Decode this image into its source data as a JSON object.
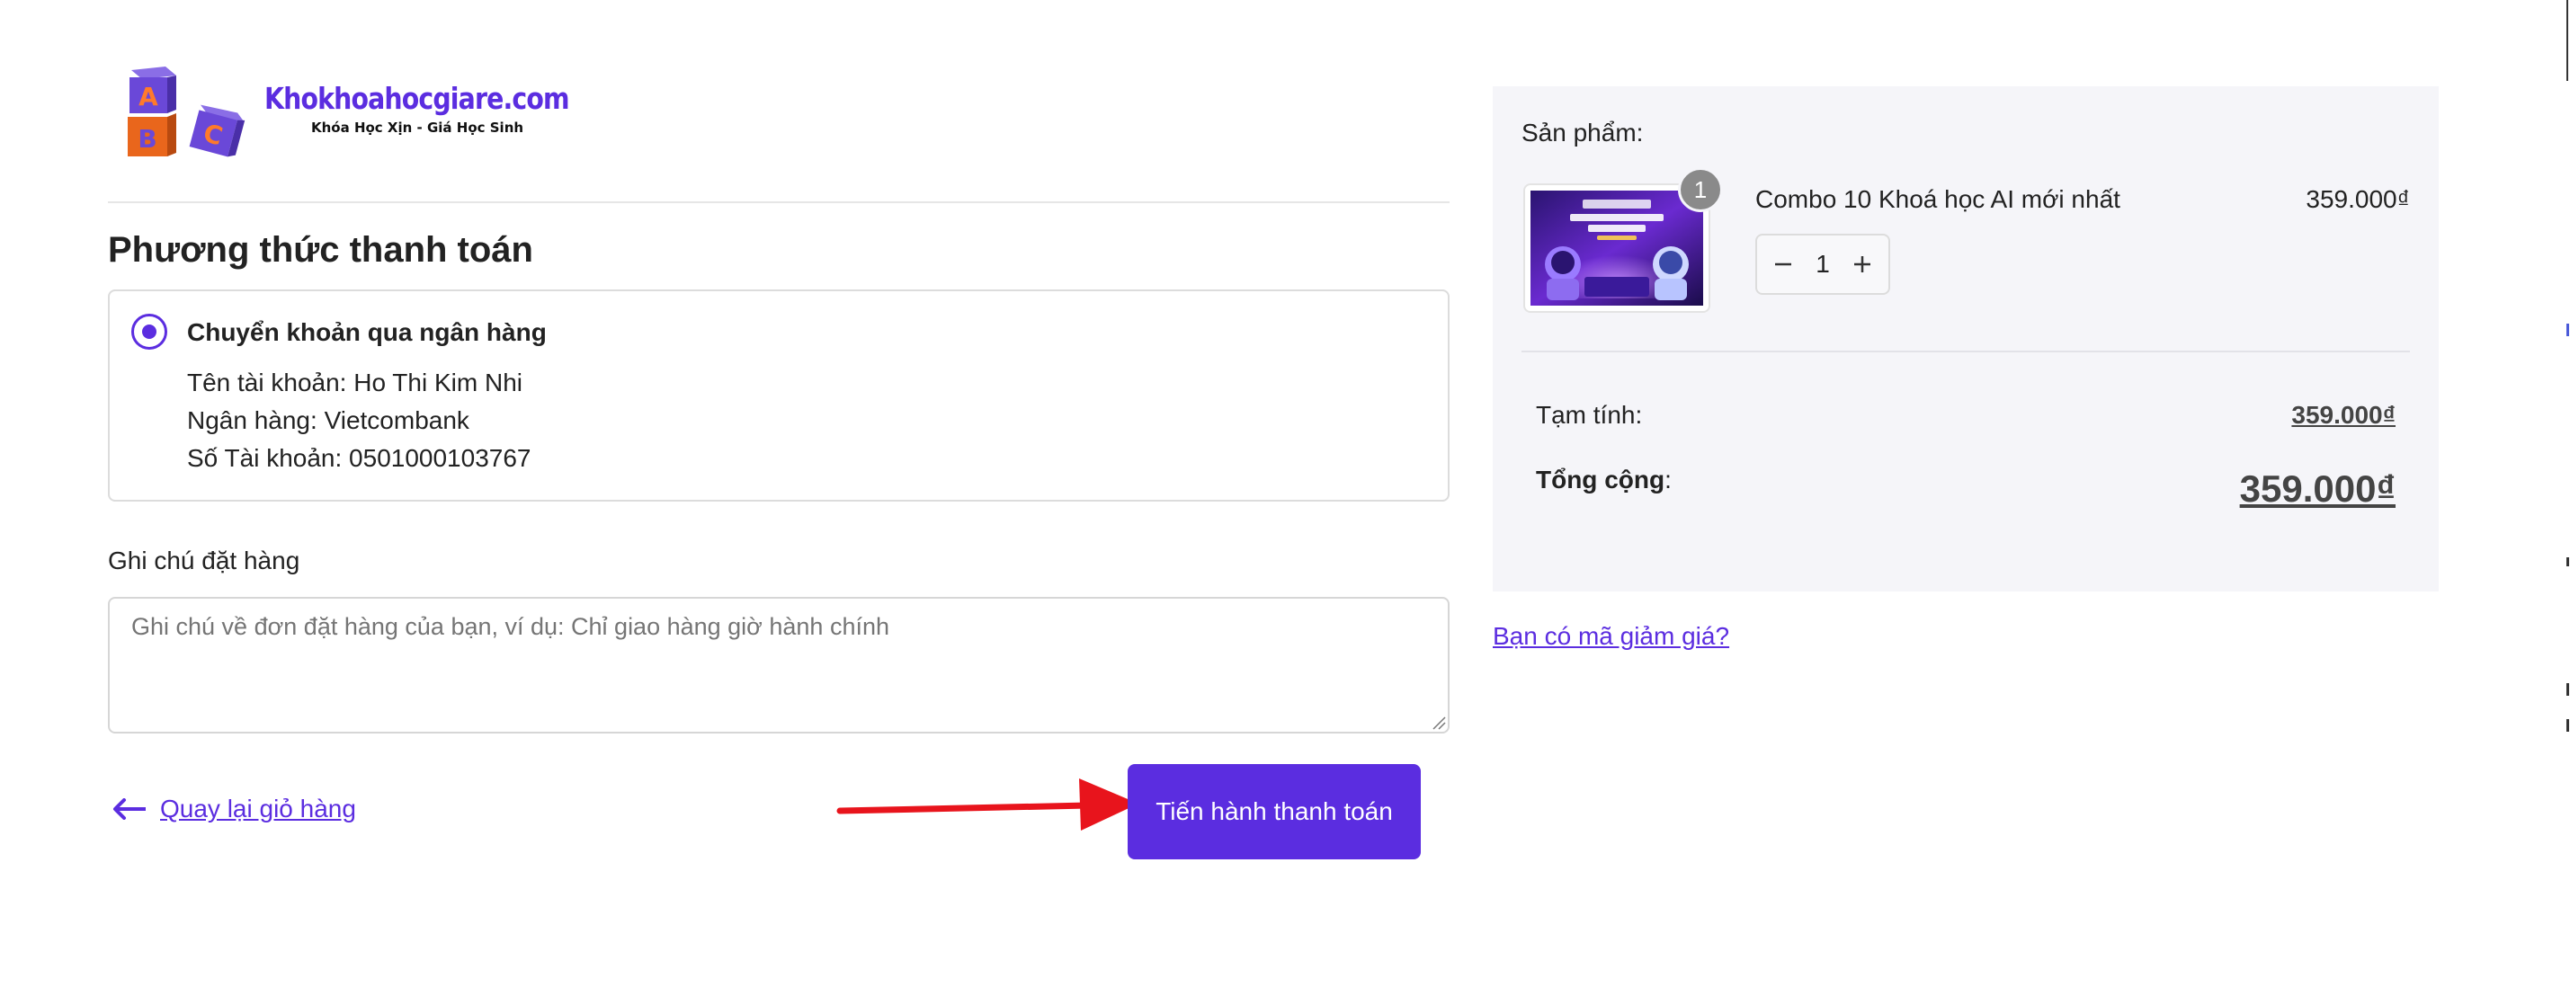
{
  "logo": {
    "brand": "Khokhoahocgiare.com",
    "tagline": "Khóa Học Xịn - Giá Học Sinh",
    "blocks": [
      "A",
      "B",
      "C"
    ]
  },
  "checkout": {
    "section_title": "Phương thức thanh toán",
    "payment_method": {
      "label": "Chuyển khoản qua ngân hàng",
      "selected": true,
      "account_name": "Tên tài khoản: Ho Thi Kim Nhi",
      "bank": "Ngân hàng: Vietcombank",
      "account_number": "Số Tài khoản: 0501000103767"
    },
    "note": {
      "label": "Ghi chú đặt hàng",
      "placeholder": "Ghi chú về đơn đặt hàng của bạn, ví dụ: Chỉ giao hàng giờ hành chính",
      "value": ""
    },
    "back_link": "Quay lại giỏ hàng",
    "submit_label": "Tiến hành thanh toán"
  },
  "summary": {
    "heading": "Sản phẩm:",
    "item": {
      "name": "Combo 10 Khoá học AI mới nhất",
      "price": "359.000₫",
      "quantity_badge": "1",
      "quantity": "1"
    },
    "subtotal_label": "Tạm tính:",
    "subtotal_value": "359.000₫",
    "total_label": "Tổng cộng",
    "total_colon": ":",
    "total_value": "359.000₫"
  },
  "coupon_link": "Bạn có mã giảm giá?",
  "colors": {
    "accent": "#5b2de0",
    "annotation_arrow": "#e8141c",
    "summary_bg": "#f5f5f9"
  },
  "icons": [
    "arrow-left-icon",
    "minus-icon",
    "plus-icon",
    "radio-selected-icon",
    "resize-grip-icon"
  ]
}
